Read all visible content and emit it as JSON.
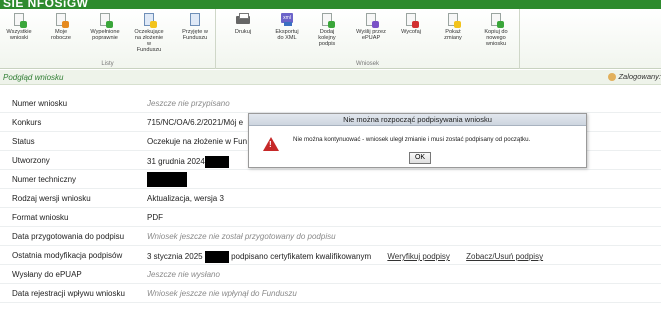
{
  "app": {
    "brand": "SIE NFOSiGW"
  },
  "ribbon": {
    "group_lists": {
      "label": "Listy",
      "buttons": [
        {
          "label": "Wszystkie wnioski",
          "icon": "document-green-icon"
        },
        {
          "label": "Moje robocze",
          "icon": "document-orange-icon"
        },
        {
          "label": "Wypełnione poprawnie",
          "icon": "document-check-icon"
        },
        {
          "label": "Oczekujące na złożenie w Funduszu",
          "icon": "document-clock-icon"
        },
        {
          "label": "Przyjęte w Funduszu",
          "icon": "document-accepted-icon"
        }
      ]
    },
    "group_wniosek": {
      "label": "Wniosek",
      "buttons": [
        {
          "label": "Drukuj",
          "icon": "printer-icon"
        },
        {
          "label": "Eksportuj do XML",
          "icon": "xml-export-icon"
        },
        {
          "label": "Dodaj kolejny podpis",
          "icon": "add-signature-icon"
        },
        {
          "label": "Wyślij przez ePUAP",
          "icon": "send-epuap-icon"
        },
        {
          "label": "Wycofaj",
          "icon": "withdraw-icon"
        },
        {
          "label": "Pokaż zmiany",
          "icon": "show-changes-icon"
        },
        {
          "label": "Kopiuj do nowego wniosku",
          "icon": "copy-icon"
        }
      ]
    }
  },
  "section": {
    "title": "Podgląd wniosku",
    "logged_in": "Zalogowany:"
  },
  "fields": [
    {
      "label": "Numer wniosku",
      "value": "Jeszcze nie przypisano",
      "italic": true
    },
    {
      "label": "Konkurs",
      "value": "715/NC/OA/6.2/2021/Mój e"
    },
    {
      "label": "Status",
      "value": "Oczekuje na złożenie w Fun"
    },
    {
      "label": "Utworzony",
      "value": "31 grudnia 2024"
    },
    {
      "label": "Numer techniczny",
      "value": ""
    },
    {
      "label": "Rodzaj wersji wniosku",
      "value": "Aktualizacja, wersja 3"
    },
    {
      "label": "Format wniosku",
      "value": "PDF"
    },
    {
      "label": "Data przygotowania do podpisu",
      "value": "Wniosek jeszcze nie został przygotowany do podpisu",
      "italic": true
    },
    {
      "label": "Ostatnia modyfikacja podpisów",
      "value": "3 stycznia 2025",
      "suffix": "podpisano certyfikatem kwalifikowanym"
    },
    {
      "label": "Wysłany do ePUAP",
      "value": "Jeszcze nie wysłano",
      "italic": true
    },
    {
      "label": "Data rejestracji wpływu wniosku",
      "value": "Wniosek jeszcze nie wpłynął do Funduszu",
      "italic": true
    }
  ],
  "links": {
    "verify": "Weryfikuj podpisy",
    "manage": "Zobacz/Usuń podpisy"
  },
  "dialog": {
    "title": "Nie można rozpocząć podpisywania wniosku",
    "message": "Nie można kontynuować - wniosek uległ zmianie i musi zostać podpisany od początku.",
    "ok": "OK"
  }
}
